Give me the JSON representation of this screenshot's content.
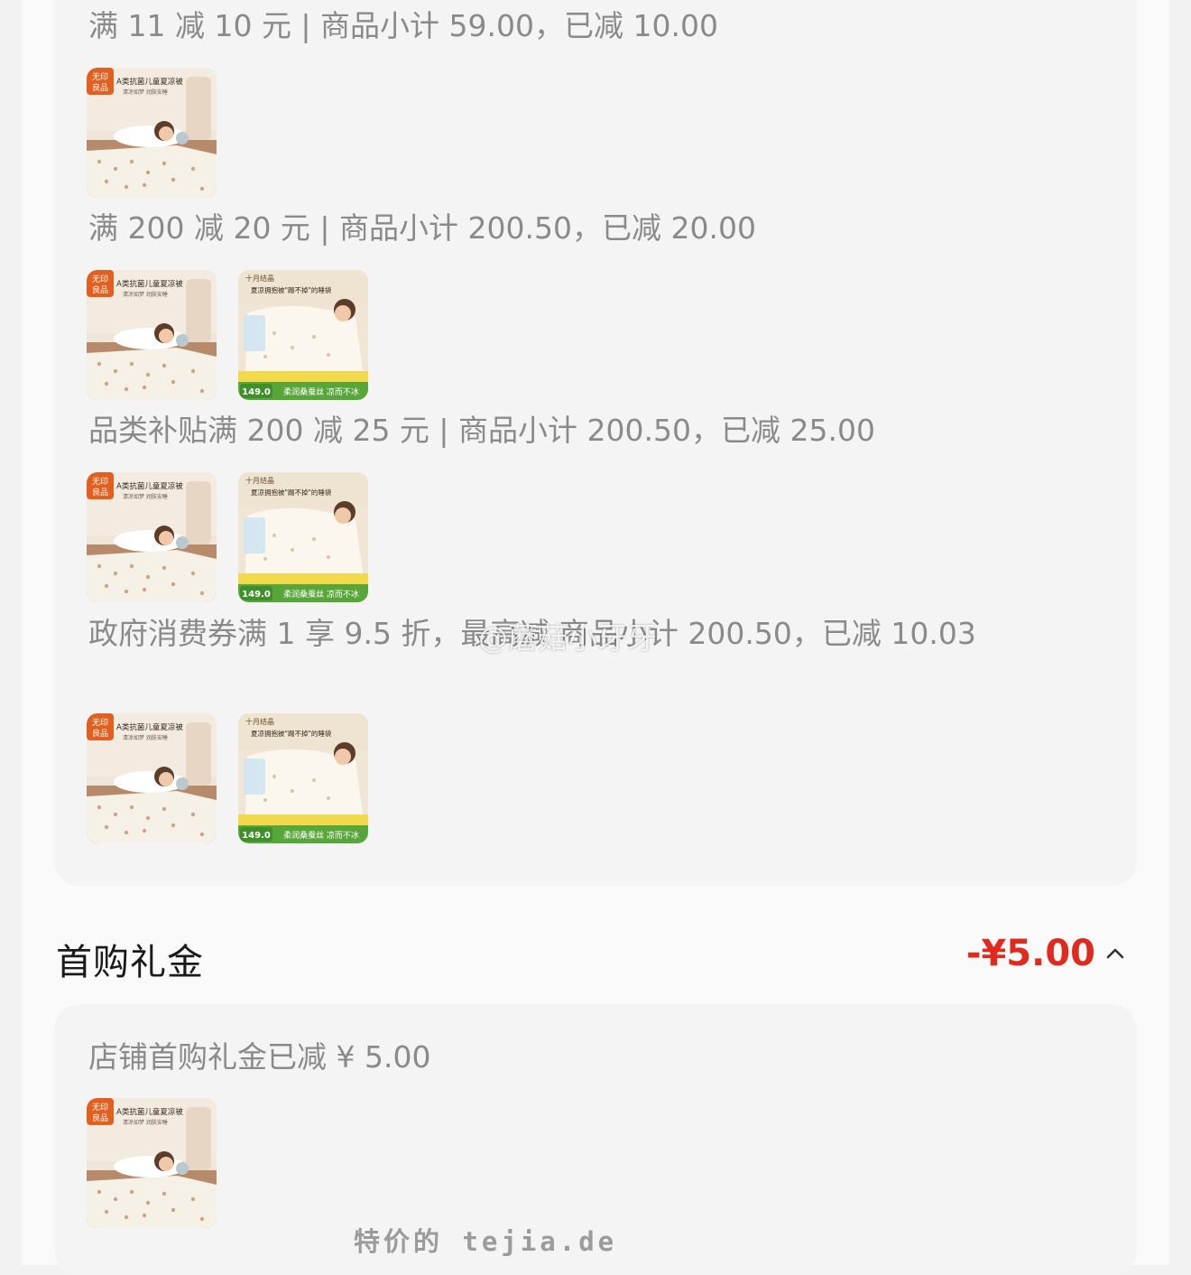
{
  "discounts": [
    {
      "text": "满 11 减 10 元 | 商品小计 59.00，已减 10.00",
      "items": [
        "blanket"
      ]
    },
    {
      "text": "满 200 减 20 元 | 商品小计 200.50，已减 20.00",
      "items": [
        "blanket",
        "sleeping-bag"
      ]
    },
    {
      "text": "品类补贴满 200 减 25 元 | 商品小计 200.50，已减 25.00",
      "items": [
        "blanket",
        "sleeping-bag"
      ]
    },
    {
      "text": "政府消费券满 1 享 9.5 折，最高减 商品小计 200.50，已减 10.03",
      "items": [
        "blanket",
        "sleeping-bag"
      ]
    }
  ],
  "products": {
    "blanket": {
      "badge": "无印\n良品",
      "headline": "A类抗菌儿童夏凉被",
      "subline": "清凉如梦 润肤安睡"
    },
    "sleeping_bag": {
      "brand": "十月结晶",
      "headline": "夏凉拥抱被\"踢不掉\"的睡袋",
      "price": "149.0",
      "banner": "柔润桑蚕丝 凉而不冰"
    }
  },
  "first_purchase": {
    "title": "首购礼金",
    "amount": "-¥5.00",
    "detail": "店铺首购礼金已减 ¥ 5.00",
    "items": [
      "blanket"
    ]
  },
  "watermarks": {
    "weibo": "@蘑菇小牙牙",
    "site": "特价的 tejia.de"
  },
  "colors": {
    "accent_red": "#e02a1d",
    "muted_text": "#8a8a8a",
    "card_bg": "#f4f4f4"
  }
}
